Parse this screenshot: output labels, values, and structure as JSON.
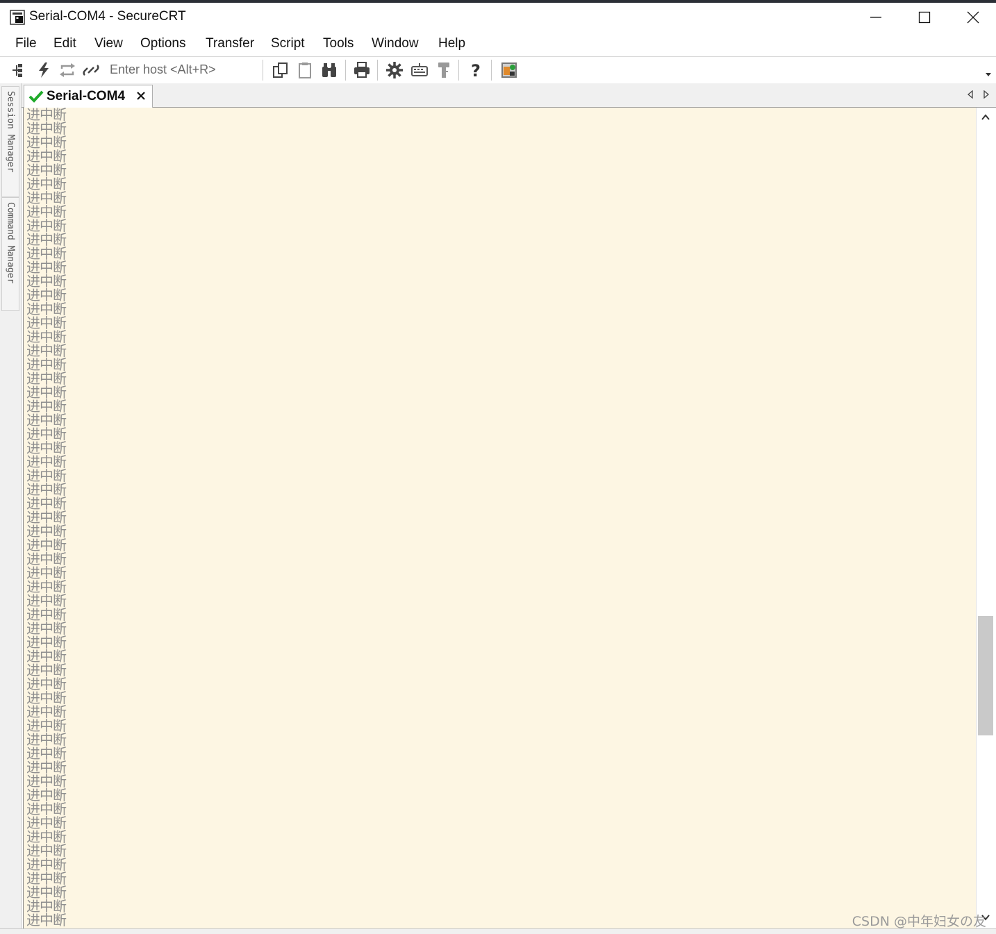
{
  "window": {
    "title": "Serial-COM4 - SecureCRT",
    "controls": [
      "minimize",
      "maximize",
      "close"
    ]
  },
  "menu": {
    "items": [
      "File",
      "Edit",
      "View",
      "Options",
      "Transfer",
      "Script",
      "Tools",
      "Window",
      "Help"
    ]
  },
  "toolbar": {
    "host_placeholder": "Enter host <Alt+R>",
    "icons": [
      "connect-icon",
      "quick-connect-icon",
      "reconnect-icon",
      "disconnect-icon",
      "copy-icon",
      "paste-icon",
      "find-icon",
      "print-icon",
      "session-options-icon",
      "keymap-icon",
      "key-agent-icon",
      "help-icon",
      "sftp-icon"
    ]
  },
  "side_panel": {
    "session_manager": "Session Manager",
    "command_manager": "Command Manager"
  },
  "tab": {
    "label": "Serial-COM4",
    "status_color": "#1faa2a"
  },
  "terminal": {
    "line_text": "进中断",
    "visible_line_count": 59,
    "background_color": "#fdf6e3",
    "text_color": "#8f8f8f"
  },
  "watermark": "CSDN @中年妇女の友"
}
